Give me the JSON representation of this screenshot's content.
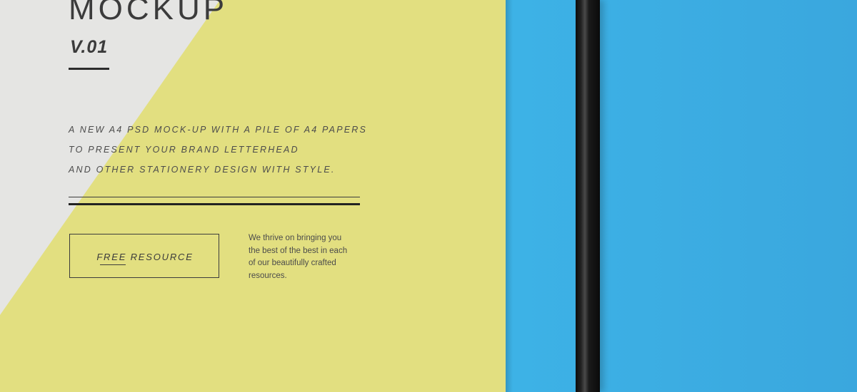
{
  "mockup": {
    "title": "MOCKUP",
    "version": "V.01",
    "description_lines": [
      "A NEW A4 PSD MOCK-UP WITH A PILE OF A4 PAPERS",
      "TO PRESENT YOUR BRAND LETTERHEAD",
      "AND  OTHER STATIONERY DESIGN WITH STYLE."
    ],
    "cta_label": "FREE RESOURCE",
    "blurb_lines": [
      "We thrive on bringing you",
      "the best of the best in each",
      "of our beautifully crafted",
      "resources."
    ]
  },
  "colors": {
    "background_blue": "#40b4e6",
    "paper_yellow": "#e2df80",
    "paper_white": "#e5e5e3",
    "pen_black": "#111111",
    "text_dark": "#3b3b3b"
  },
  "icons": []
}
